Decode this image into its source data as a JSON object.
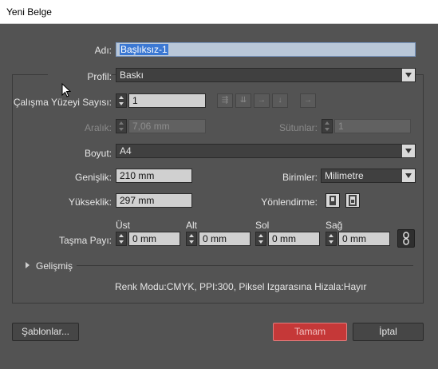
{
  "window": {
    "title": "Yeni Belge"
  },
  "document": {
    "name_label": "Adı:",
    "name_value": "Başlıksız-1"
  },
  "profile": {
    "label": "Profil:",
    "value": "Baskı"
  },
  "artboards": {
    "count_label": "Çalışma Yüzeyi Sayısı:",
    "count_value": "1",
    "spacing_label": "Aralık:",
    "spacing_value": "7,06 mm",
    "columns_label": "Sütunlar:",
    "columns_value": "1",
    "layout_icons": [
      "grid-by-row-icon",
      "grid-by-column-icon",
      "arrange-by-row-icon",
      "arrange-by-column-icon",
      "right-to-left-icon"
    ]
  },
  "size": {
    "label": "Boyut:",
    "value": "A4"
  },
  "width": {
    "label": "Genişlik:",
    "value": "210 mm"
  },
  "units": {
    "label": "Birimler:",
    "value": "Milimetre"
  },
  "height": {
    "label": "Yükseklik:",
    "value": "297 mm"
  },
  "orientation": {
    "label": "Yönlendirme:",
    "icons": [
      "portrait-icon",
      "landscape-icon"
    ]
  },
  "bleed": {
    "label": "Taşma Payı:",
    "top_label": "Üst",
    "top_value": "0 mm",
    "bottom_label": "Alt",
    "bottom_value": "0 mm",
    "left_label": "Sol",
    "left_value": "0 mm",
    "right_label": "Sağ",
    "right_value": "0 mm",
    "link_icon": "chain-link-icon"
  },
  "advanced": {
    "label": "Gelişmiş"
  },
  "summary": {
    "text": "Renk Modu:CMYK, PPI:300, Piksel Izgarasına Hizala:Hayır"
  },
  "footer": {
    "templates_label": "Şablonlar...",
    "ok_label": "Tamam",
    "cancel_label": "İptal"
  },
  "colors": {
    "background": "#535353",
    "primary_button": "#c53838",
    "selection": "#3b78d3"
  }
}
